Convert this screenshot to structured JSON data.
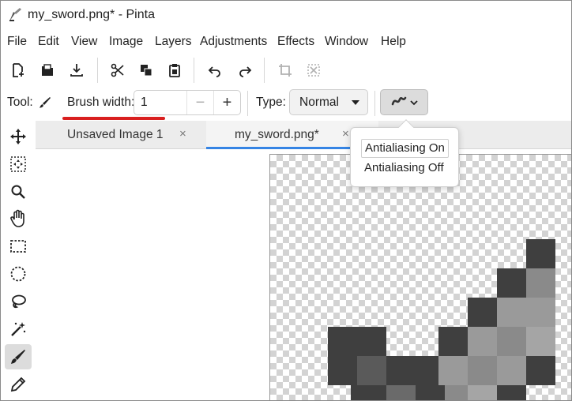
{
  "window": {
    "title": "my_sword.png* - Pinta"
  },
  "menu": [
    "File",
    "Edit",
    "View",
    "Image",
    "Layers",
    "Adjustments",
    "Effects",
    "Window",
    "Help"
  ],
  "toolbar": {
    "buttons": [
      "new-image-icon",
      "open-icon",
      "save-icon",
      "cut-icon",
      "copy-icon",
      "paste-icon",
      "undo-icon",
      "redo-icon",
      "crop-icon",
      "deselect-icon"
    ]
  },
  "tool_options": {
    "tool_label": "Tool:",
    "brush_width_label": "Brush width:",
    "brush_width_value": "1",
    "minus": "−",
    "plus": "+",
    "type_label": "Type:",
    "type_value": "Normal"
  },
  "antialias_menu": {
    "options": [
      "Antialiasing On",
      "Antialiasing Off"
    ],
    "highlighted": "Antialiasing Off"
  },
  "tabs": [
    {
      "label": "Unsaved Image 1",
      "close": "×",
      "active": false
    },
    {
      "label": "my_sword.png*",
      "close": "×",
      "active": true
    }
  ],
  "tools": [
    "move-selected-icon",
    "move-selection-icon",
    "zoom-icon",
    "pan-icon",
    "rectangle-select-icon",
    "ellipse-select-icon",
    "lasso-select-icon",
    "magic-wand-icon",
    "paintbrush-icon",
    "pencil-icon"
  ],
  "active_tool": "paintbrush-icon",
  "colors": {
    "accent": "#3584e4",
    "annotation": "#d91f1f"
  }
}
